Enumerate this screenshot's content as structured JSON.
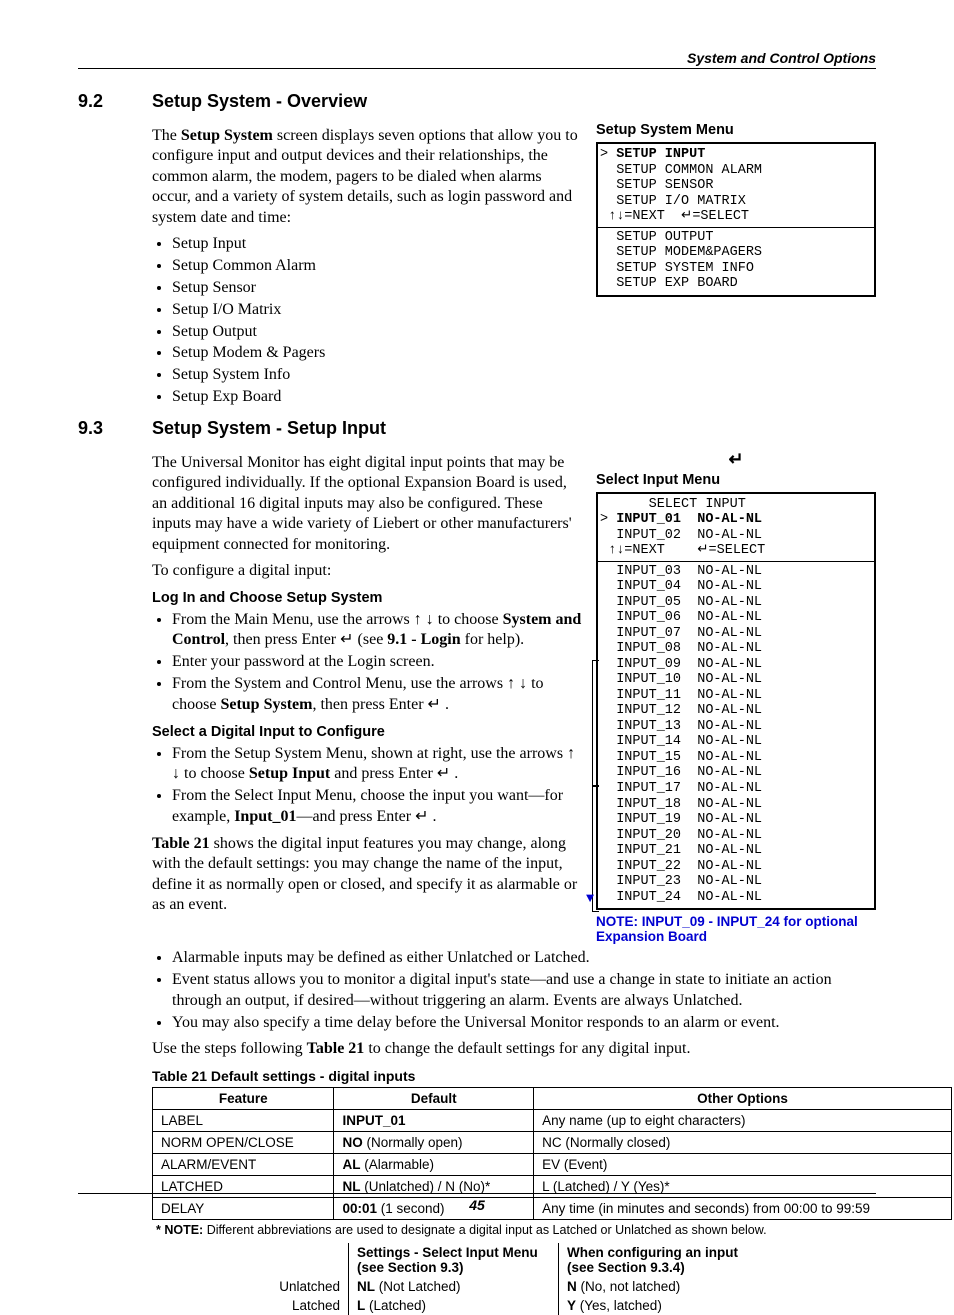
{
  "header": "System and Control Options",
  "s92": {
    "num": "9.2",
    "title": "Setup System - Overview",
    "intro_a": "The ",
    "intro_b": "Setup System",
    "intro_c": " screen displays seven options that allow you to configure input and output devices and their relationships, the common alarm, the modem, pagers to be dialed when alarms occur, and a variety of system details, such as login password and system date and time:",
    "items": [
      "Setup Input",
      "Setup Common Alarm",
      "Setup Sensor",
      "Setup I/O Matrix",
      "Setup Output",
      "Setup Modem & Pagers",
      "Setup System Info",
      "Setup Exp Board"
    ]
  },
  "setup_menu": {
    "title": "Setup System Menu",
    "rows1": [
      {
        "sel": ">",
        "txt": "SETUP INPUT",
        "bold": true
      },
      {
        "sel": " ",
        "txt": "SETUP COMMON ALARM"
      },
      {
        "sel": " ",
        "txt": "SETUP SENSOR"
      },
      {
        "sel": " ",
        "txt": "SETUP I/O MATRIX"
      }
    ],
    "nav1": "↑↓=NEXT  ↵=SELECT",
    "rows2": [
      {
        "sel": " ",
        "txt": "SETUP OUTPUT"
      },
      {
        "sel": " ",
        "txt": "SETUP MODEM&PAGERS"
      },
      {
        "sel": " ",
        "txt": "SETUP SYSTEM INFO"
      },
      {
        "sel": " ",
        "txt": "SETUP EXP BOARD"
      }
    ]
  },
  "s93": {
    "num": "9.3",
    "title": "Setup System - Setup Input",
    "p1": "The Universal Monitor has eight digital input points that may be configured individually. If the optional Expansion Board is used, an additional 16 digital inputs may also be configured. These inputs may have a wide variety of Liebert or other manufacturers' equipment connected for monitoring.",
    "p2": "To configure a digital input:",
    "h1": "Log In and Choose Setup System",
    "b1a": "From the Main Menu, use the arrows ↑ ↓ to choose ",
    "b1b": "System and Control",
    "b1c": ", then press Enter ↵ (see ",
    "b1d": "9.1 - Login",
    "b1e": " for help).",
    "b2": "Enter your password at the Login screen.",
    "b3a": "From the System and Control Menu, use the arrows ↑ ↓ to choose ",
    "b3b": "Setup System",
    "b3c": ", then press Enter ↵ .",
    "h2": "Select a Digital Input to Configure",
    "b4a": "From the Setup System Menu, shown at right, use the arrows ↑ ↓ to choose ",
    "b4b": "Setup Input",
    "b4c": " and press Enter ↵ .",
    "b5a": "From the Select Input Menu, choose the input you want—for example, ",
    "b5b": "Input_01",
    "b5c": "—and press Enter ↵ .",
    "p3a": "Table 21",
    "p3b": " shows the digital input features you may change, along with the default settings: you may change the name of the input, define it as normally open or closed, and specify it as alarmable or as an event.",
    "b6": "Alarmable inputs may be defined as either Unlatched or Latched.",
    "b7": "Event status allows you to monitor a digital input's state—and use a change in state to initiate an action through an output, if desired—without triggering an alarm. Events are always Unlatched.",
    "b8": "You may also specify a time delay before the Universal Monitor responds to an alarm or event.",
    "p4a": "Use the steps following ",
    "p4b": "Table 21",
    "p4c": " to change the default settings for any digital input."
  },
  "select_menu": {
    "enter": "↵",
    "title": "Select Input Menu",
    "hdr": "      SELECT INPUT",
    "rows_top": [
      {
        "sel": ">",
        "name": "INPUT_01",
        "st": "NO-AL-NL",
        "bold": true
      },
      {
        "sel": " ",
        "name": "INPUT_02",
        "st": "NO-AL-NL"
      }
    ],
    "nav": " ↑↓=NEXT    ↵=SELECT",
    "rows_rest": [
      "INPUT_03",
      "INPUT_04",
      "INPUT_05",
      "INPUT_06",
      "INPUT_07",
      "INPUT_08",
      "INPUT_09",
      "INPUT_10",
      "INPUT_11",
      "INPUT_12",
      "INPUT_13",
      "INPUT_14",
      "INPUT_15",
      "INPUT_16",
      "INPUT_17",
      "INPUT_18",
      "INPUT_19",
      "INPUT_20",
      "INPUT_21",
      "INPUT_22",
      "INPUT_23",
      "INPUT_24"
    ],
    "st_rest": "NO-AL-NL",
    "note": "NOTE: INPUT_09 - INPUT_24 for optional Expansion Board"
  },
  "table21": {
    "cap": "Table 21    Default settings - digital inputs",
    "cols": [
      "Feature",
      "Default",
      "Other Options"
    ],
    "rows": [
      {
        "f": "LABEL",
        "d": "INPUT_01",
        "db": true,
        "o": "Any name (up to eight characters)"
      },
      {
        "f": "NORM OPEN/CLOSE",
        "d": "NO",
        "dn": " (Normally open)",
        "db": true,
        "o": "NC (Normally closed)"
      },
      {
        "f": "ALARM/EVENT",
        "d": "AL",
        "dn": " (Alarmable)",
        "db": true,
        "o": "EV (Event)"
      },
      {
        "f": "LATCHED",
        "d": "NL",
        "dn": " (Unlatched) / N (No)*",
        "db": true,
        "o": "L (Latched) / Y (Yes)*"
      },
      {
        "f": "DELAY",
        "d": "00:01",
        "dn": " (1 second)",
        "db": true,
        "o": "Any time (in minutes and seconds) from 00:00 to 99:59"
      }
    ],
    "note": "* NOTE: Different abbreviations are used to designate a digital input as Latched or Unlatched as shown below.",
    "abbr": {
      "h1": "Settings - Select Input Menu",
      "h1s": "(see Section 9.3)",
      "h2": "When configuring an input",
      "h2s": "(see Section 9.3.4)",
      "r1l": "Unlatched",
      "r1a": "NL",
      "r1an": " (Not Latched)",
      "r1b": "N",
      "r1bn": " (No, not latched)",
      "r2l": "Latched",
      "r2a": "L",
      "r2an": " (Latched)",
      "r2b": "Y",
      "r2bn": " (Yes, latched)"
    }
  },
  "page": "45"
}
